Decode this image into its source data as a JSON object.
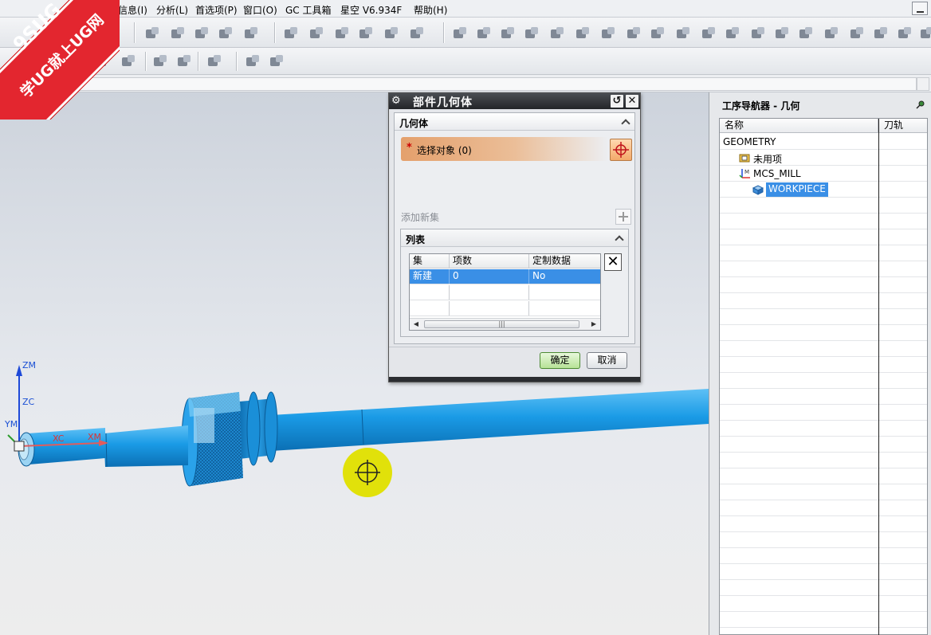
{
  "menu": {
    "items": [
      "信息(I)",
      "分析(L)",
      "首选项(P)",
      "窗口(O)",
      "GC 工具箱",
      "星空 V6.934F",
      "帮助(H)"
    ]
  },
  "watermark": {
    "line1": "9SUG",
    "line2": "学UG就上UG网"
  },
  "viewport": {
    "axes": {
      "zm": "ZM",
      "zc": "ZC",
      "ym": "YM",
      "xc": "XC",
      "xm": "XM"
    }
  },
  "dialog": {
    "title": "部件几何体",
    "geometry_group": "几何体",
    "select_object": "选择对象 (0)",
    "required_mark": "*",
    "add_new_set": "添加新集",
    "list_group": "列表",
    "table": {
      "headers": [
        "集",
        "项数",
        "定制数据"
      ],
      "rows": [
        [
          "新建",
          "0",
          "No"
        ]
      ]
    },
    "ok": "确定",
    "cancel": "取消"
  },
  "navigator": {
    "title": "工序导航器 - 几何",
    "columns": [
      "名称",
      "刀轨"
    ],
    "rows": [
      {
        "label": "GEOMETRY",
        "level": 0,
        "icon": "",
        "selected": false
      },
      {
        "label": "未用项",
        "level": 1,
        "icon": "folder-icon",
        "selected": false
      },
      {
        "label": "MCS_MILL",
        "level": 1,
        "icon": "csys-icon",
        "selected": false
      },
      {
        "label": "WORKPIECE",
        "level": 2,
        "icon": "workpiece-icon",
        "selected": true
      }
    ]
  },
  "colors": {
    "part_blue": "#1a9be6",
    "selection_blue": "#3a8fe6",
    "cursor_yellow": "#e1e10a",
    "watermark_red": "#e3262f"
  }
}
